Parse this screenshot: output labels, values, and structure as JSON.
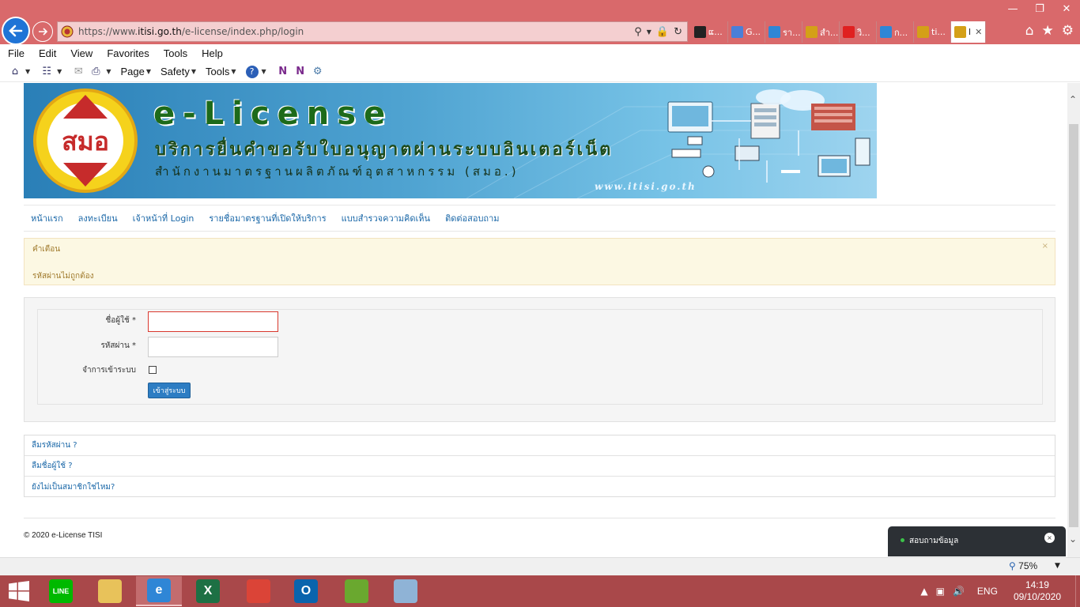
{
  "browser": {
    "url_prefix": "https://www.",
    "url_host": "itisi.go.th",
    "url_path": "/e-license/index.php/login",
    "tabs": [
      {
        "label": "ແ...",
        "color": "#222222",
        "icon": "d-icon"
      },
      {
        "label": "G...",
        "color": "#4a7fd8",
        "icon": "google-translate-icon"
      },
      {
        "label": "รา...",
        "color": "#2f86d6",
        "icon": "ie-icon"
      },
      {
        "label": "สำ...",
        "color": "#d4a017",
        "icon": "tisi-icon"
      },
      {
        "label": "วิ...",
        "color": "#e02020",
        "icon": "youtube-icon"
      },
      {
        "label": "ก...",
        "color": "#2f86d6",
        "icon": "ie-icon"
      },
      {
        "label": "ti...",
        "color": "#d4a017",
        "icon": "tisi-icon"
      },
      {
        "label": "l",
        "color": "#d4a017",
        "icon": "tisi-icon",
        "active": true
      }
    ],
    "menu": [
      "File",
      "Edit",
      "View",
      "Favorites",
      "Tools",
      "Help"
    ],
    "cmd_labels": {
      "page": "Page",
      "safety": "Safety",
      "tools": "Tools"
    },
    "zoom": "75%"
  },
  "banner": {
    "logo_text": "สมอ",
    "title": "e-License",
    "subtitle": "บริการยื่นคำขอรับใบอนุญาตผ่านระบบอินเตอร์เน็ต",
    "org": "สำนักงานมาตรฐานผลิตภัณฑ์อุตสาหกรรม (สมอ.)",
    "site": "www.itisi.go.th"
  },
  "nav": [
    "หน้าแรก",
    "ลงทะเบียน",
    "เจ้าหน้าที่ Login",
    "รายชื่อมาตรฐานที่เปิดให้บริการ",
    "แบบสำรวจความคิดเห็น",
    "ติดต่อสอบถาม"
  ],
  "alert": {
    "title": "คำเตือน",
    "message": "รหัสผ่านไม่ถูกต้อง",
    "close": "×"
  },
  "login": {
    "username_label": "ชื่อผู้ใช้ *",
    "username_value": "",
    "password_label": "รหัสผ่าน *",
    "password_value": "",
    "remember_label": "จำการเข้าระบบ",
    "submit_label": "เข้าสู่ระบบ"
  },
  "links": [
    "ลืมรหัสผ่าน ?",
    "ลืมชื่อผู้ใช้ ?",
    "ยังไม่เป็นสมาชิกใช่ไหม?"
  ],
  "footer": "© 2020 e-License TISI",
  "chat": {
    "label": "สอบถามข้อมูล",
    "close": "×"
  },
  "taskbar": {
    "lang": "ENG",
    "time": "14:19",
    "date": "09/10/2020",
    "apps": [
      {
        "name": "line-app",
        "text": "LINE",
        "color": "#00b900",
        "running": false
      },
      {
        "name": "file-explorer-app",
        "text": "",
        "color": "#e8c25a",
        "running": false
      },
      {
        "name": "internet-explorer-app",
        "text": "e",
        "color": "#2f86d6",
        "running": true
      },
      {
        "name": "excel-app",
        "text": "X",
        "color": "#1d7044",
        "running": false
      },
      {
        "name": "chrome-app",
        "text": "",
        "color": "#db4437",
        "running": false
      },
      {
        "name": "outlook-app",
        "text": "O",
        "color": "#0a64ad",
        "running": false
      },
      {
        "name": "bluestacks-app",
        "text": "",
        "color": "#6aa82f",
        "running": false
      },
      {
        "name": "paint-app",
        "text": "",
        "color": "#8fb3d6",
        "running": false
      }
    ]
  }
}
